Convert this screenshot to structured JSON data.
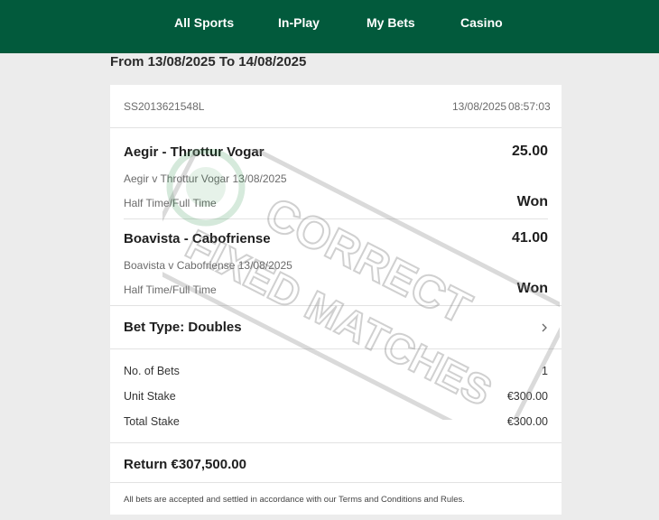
{
  "nav": {
    "items": [
      {
        "label": "All Sports"
      },
      {
        "label": "In-Play"
      },
      {
        "label": "My Bets"
      },
      {
        "label": "Casino"
      }
    ]
  },
  "date_range": "From 13/08/2025 To 14/08/2025",
  "bet": {
    "ref": "SS2013621548L",
    "placed_date": "13/08/2025",
    "placed_time": "08:57:03",
    "selections": [
      {
        "selection": "Aegir - Throttur Vogar",
        "odds": "25.00",
        "event": "Aegir v Throttur Vogar 13/08/2025",
        "market": "Half Time/Full Time",
        "result": "Won"
      },
      {
        "selection": "Boavista - Cabofriense",
        "odds": "41.00",
        "event": "Boavista v Cabofriense 13/08/2025",
        "market": "Half Time/Full Time",
        "result": "Won"
      }
    ],
    "bet_type": "Bet Type: Doubles",
    "summary": [
      {
        "label": "No. of Bets",
        "value": "1"
      },
      {
        "label": "Unit Stake",
        "value": "€300.00"
      },
      {
        "label": "Total Stake",
        "value": "€300.00"
      }
    ],
    "return_text": "Return €307,500.00",
    "disclaimer": "All bets are accepted and settled in accordance with our Terms and Conditions and Rules."
  },
  "watermark": {
    "line1": "CORRECT",
    "line2": "FIXED MATCHES"
  },
  "colors": {
    "header_bg": "#025a3c",
    "page_bg": "#ececec",
    "card_bg": "#ffffff"
  }
}
